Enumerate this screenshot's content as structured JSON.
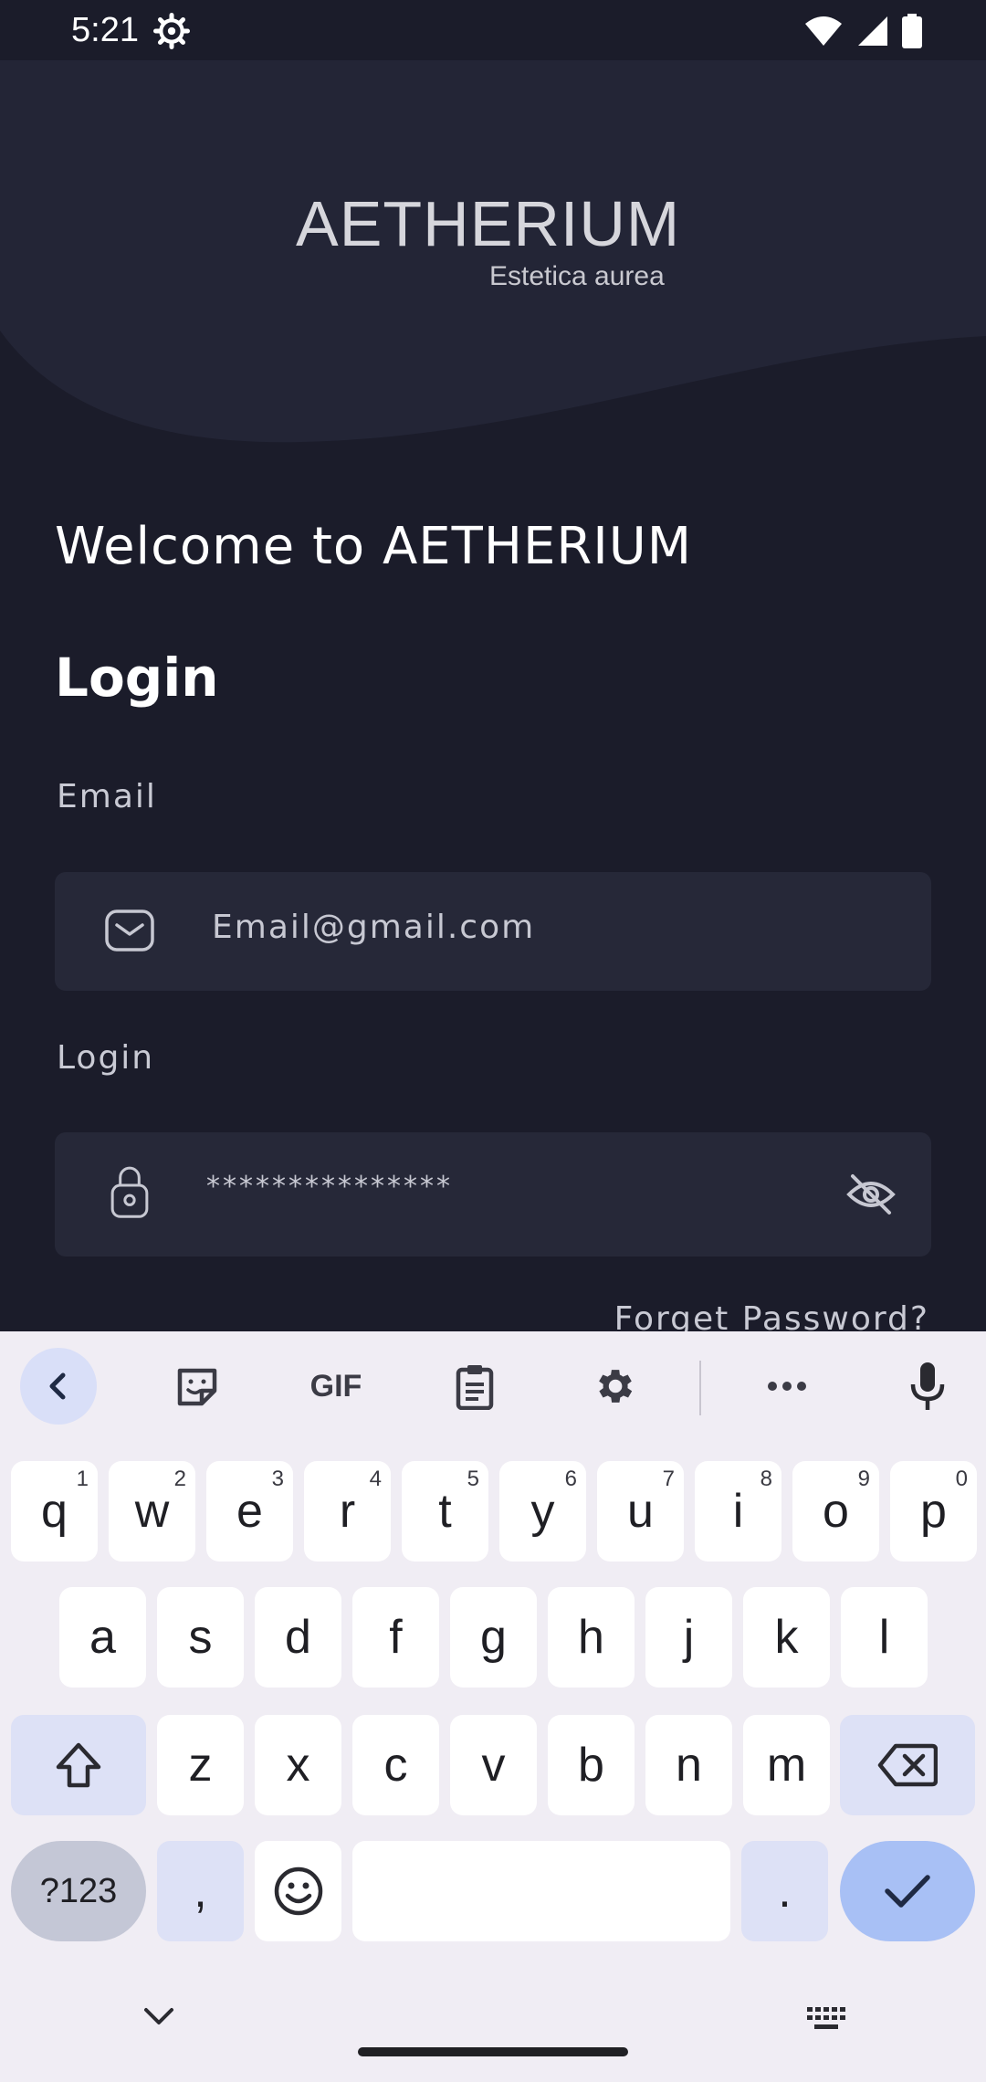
{
  "status_bar": {
    "time": "5:21",
    "icons": [
      "settings-gear-icon",
      "wifi-icon",
      "signal-icon",
      "battery-icon"
    ]
  },
  "header": {
    "logo": "AETHERIUM",
    "tagline": "Estetica aurea"
  },
  "welcome": "Welcome to  AETHERIUM",
  "login_title": "Login",
  "form": {
    "email_label": "Email",
    "email_value": "Email@gmail.com",
    "password_label": "Login",
    "password_value": "***************",
    "forgot": "Forget Password?"
  },
  "keyboard": {
    "toolbar": [
      "back-icon",
      "sticker-icon",
      "GIF",
      "clipboard-icon",
      "settings-icon",
      "more-icon",
      "mic-icon"
    ],
    "gif_label": "GIF",
    "row1": [
      {
        "k": "q",
        "s": "1"
      },
      {
        "k": "w",
        "s": "2"
      },
      {
        "k": "e",
        "s": "3"
      },
      {
        "k": "r",
        "s": "4"
      },
      {
        "k": "t",
        "s": "5"
      },
      {
        "k": "y",
        "s": "6"
      },
      {
        "k": "u",
        "s": "7"
      },
      {
        "k": "i",
        "s": "8"
      },
      {
        "k": "o",
        "s": "9"
      },
      {
        "k": "p",
        "s": "0"
      }
    ],
    "row2": [
      "a",
      "s",
      "d",
      "f",
      "g",
      "h",
      "j",
      "k",
      "l"
    ],
    "row3": [
      "z",
      "x",
      "c",
      "v",
      "b",
      "n",
      "m"
    ],
    "symbols_key": "?123",
    "comma_key": ",",
    "period_key": "."
  },
  "colors": {
    "background": "#1b1c2a",
    "header": "#232536",
    "input_bg": "#262838",
    "keyboard_bg": "#f0edf4",
    "accent_key": "#a8c0f5"
  }
}
